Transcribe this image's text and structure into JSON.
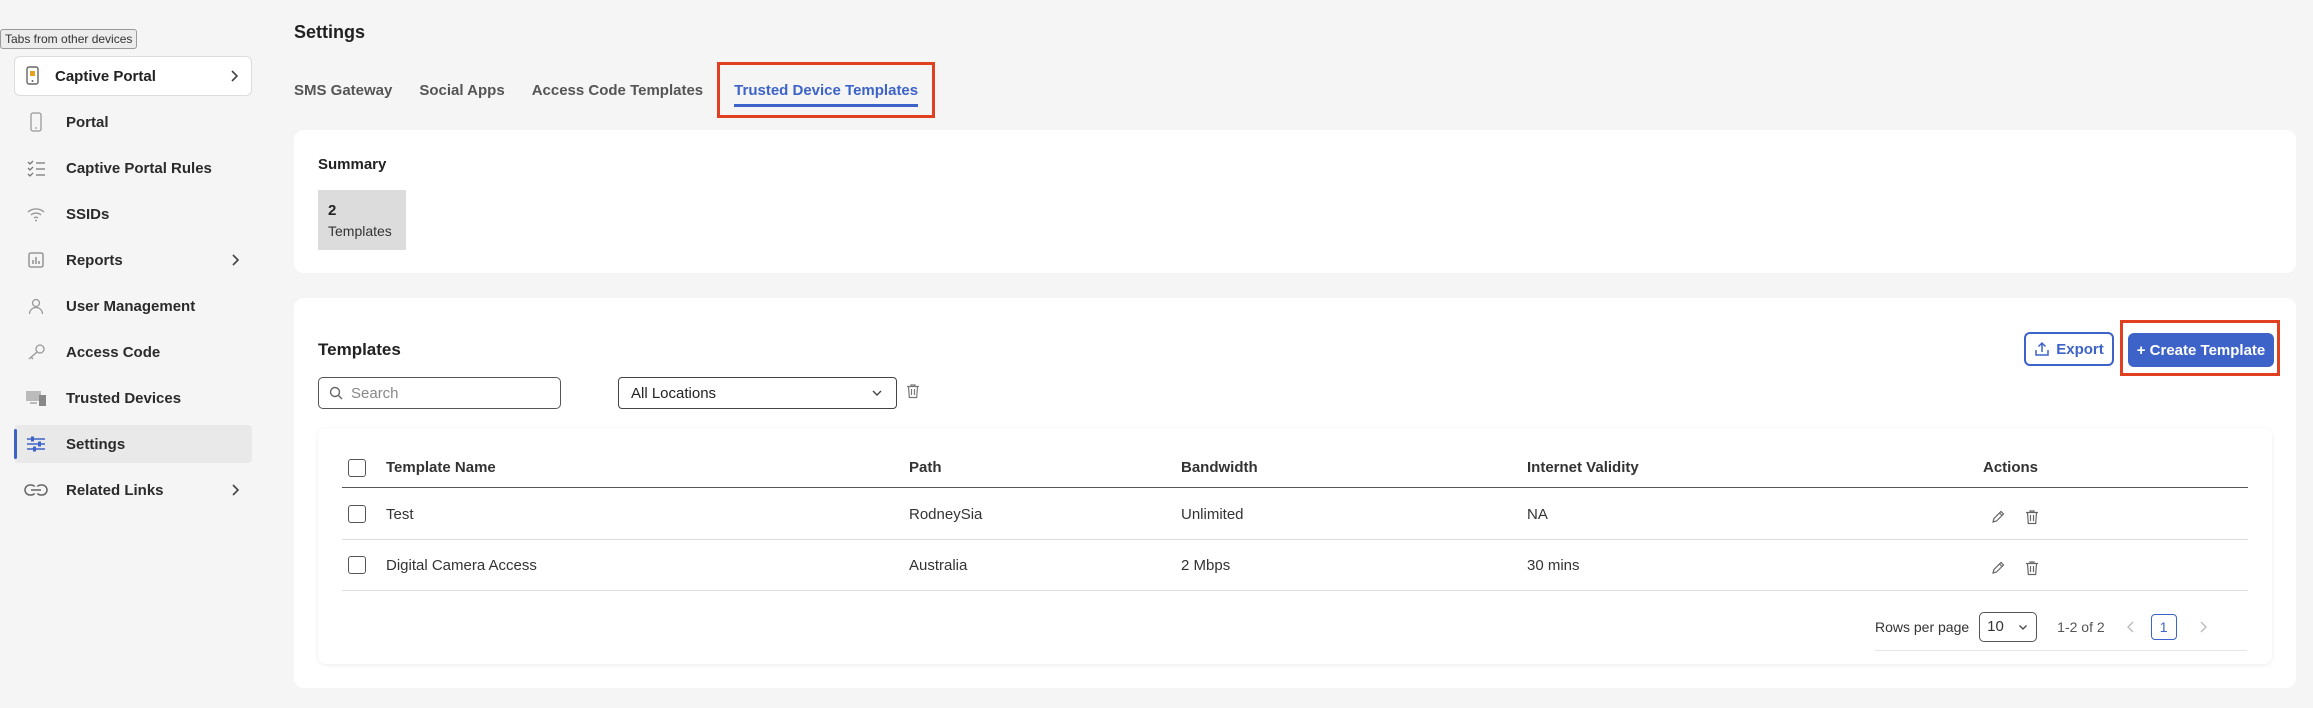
{
  "tooltip": "Tabs from other devices",
  "sidebar": {
    "group": {
      "label": "Captive Portal"
    },
    "items": [
      {
        "label": "Portal",
        "icon": "phone-icon"
      },
      {
        "label": "Captive Portal Rules",
        "icon": "checklist-icon"
      },
      {
        "label": "SSIDs",
        "icon": "wifi-icon"
      },
      {
        "label": "Reports",
        "icon": "report-chart-icon"
      },
      {
        "label": "User Management",
        "icon": "user-icon"
      },
      {
        "label": "Access Code",
        "icon": "key-icon"
      },
      {
        "label": "Trusted Devices",
        "icon": "devices-icon"
      },
      {
        "label": "Settings",
        "icon": "sliders-icon"
      },
      {
        "label": "Related Links",
        "icon": "link-icon"
      }
    ]
  },
  "page": {
    "title": "Settings"
  },
  "tabs": [
    {
      "label": "SMS Gateway"
    },
    {
      "label": "Social Apps"
    },
    {
      "label": "Access Code Templates"
    },
    {
      "label": "Trusted Device Templates"
    }
  ],
  "summary": {
    "title": "Summary",
    "count": "2",
    "caption": "Templates"
  },
  "templates": {
    "title": "Templates",
    "export_label": "Export",
    "create_label": "+ Create Template",
    "search_placeholder": "Search",
    "location_value": "All Locations",
    "columns": [
      "Template Name",
      "Path",
      "Bandwidth",
      "Internet Validity",
      "Actions"
    ],
    "rows": [
      {
        "name": "Test",
        "path": "RodneySia",
        "bandwidth": "Unlimited",
        "validity": "NA"
      },
      {
        "name": "Digital Camera Access",
        "path": "Australia",
        "bandwidth": "2 Mbps",
        "validity": "30 mins"
      }
    ],
    "pagination": {
      "rows_per_page_label": "Rows per page",
      "rows_per_page_value": "10",
      "range": "1-2 of 2",
      "current_page": "1"
    }
  },
  "colors": {
    "accent": "#3d63c9",
    "highlight": "#e0401f"
  }
}
